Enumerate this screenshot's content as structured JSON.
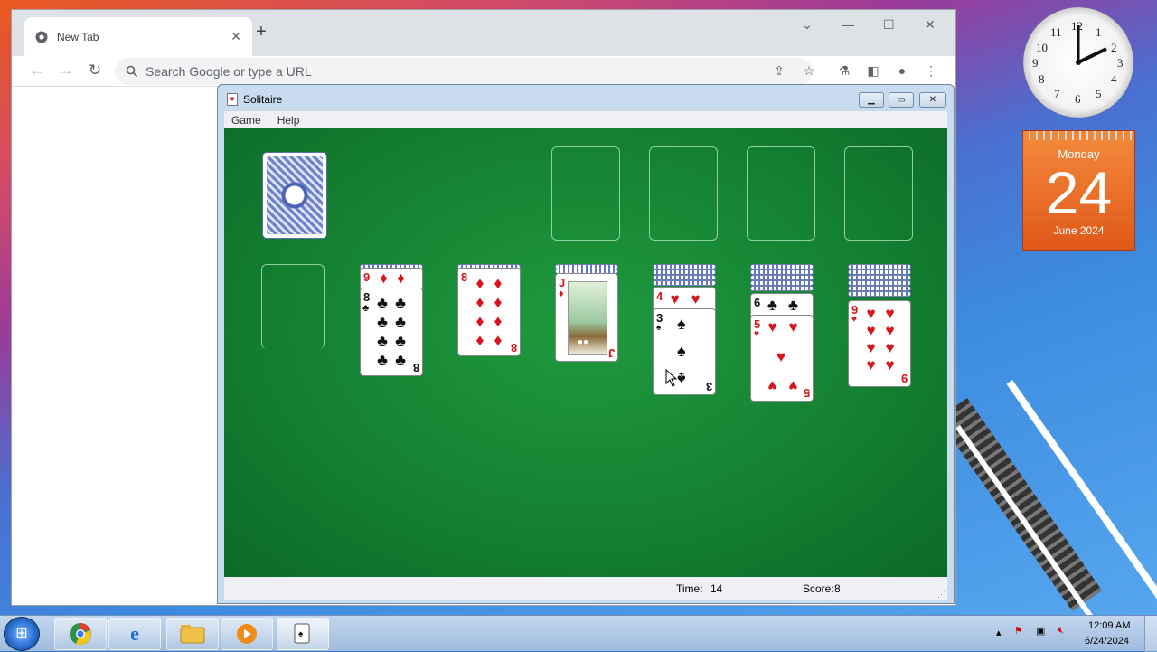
{
  "chrome": {
    "tab_title": "New Tab",
    "omnibox_placeholder": "Search Google or type a URL"
  },
  "solitaire": {
    "title": "Solitaire",
    "menu": [
      "Game",
      "Help"
    ],
    "time_label": "Time:",
    "time_value": "14",
    "score_label": "Score:",
    "score_value": "8",
    "tableau": [
      {
        "face_down": 0,
        "face_up": []
      },
      {
        "face_down": 1,
        "face_up": [
          {
            "rank": "9",
            "suit": "♦",
            "color": "red"
          },
          {
            "rank": "8",
            "suit": "♣",
            "color": "black"
          }
        ]
      },
      {
        "face_down": 1,
        "face_up": [
          {
            "rank": "8",
            "suit": "♦",
            "color": "red"
          }
        ]
      },
      {
        "face_down": 2,
        "face_up": [
          {
            "rank": "J",
            "suit": "♦",
            "color": "red"
          }
        ]
      },
      {
        "face_down": 4,
        "face_up": [
          {
            "rank": "4",
            "suit": "♥",
            "color": "red"
          },
          {
            "rank": "3",
            "suit": "♠",
            "color": "black"
          }
        ]
      },
      {
        "face_down": 5,
        "face_up": [
          {
            "rank": "6",
            "suit": "♣",
            "color": "black"
          },
          {
            "rank": "5",
            "suit": "♥",
            "color": "red"
          }
        ]
      },
      {
        "face_down": 6,
        "face_up": [
          {
            "rank": "9",
            "suit": "♥",
            "color": "red"
          }
        ]
      }
    ]
  },
  "gadgets": {
    "calendar_day": "Monday",
    "calendar_date": "24",
    "calendar_month": "June 2024",
    "clock_numbers": [
      "12",
      "1",
      "2",
      "3",
      "4",
      "5",
      "6",
      "7",
      "8",
      "9",
      "10",
      "11"
    ]
  },
  "taskbar": {
    "time": "12:09 AM",
    "date": "6/24/2024"
  },
  "colors": {
    "felt": "#168634",
    "red_suit": "#d8141c",
    "calendar": "#e8671f"
  }
}
